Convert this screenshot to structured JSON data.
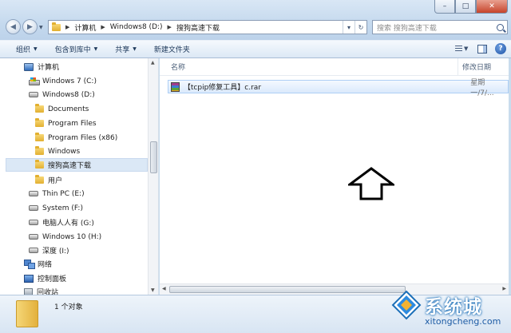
{
  "window": {
    "minimize_glyph": "–",
    "maximize_glyph": "□",
    "close_glyph": "✕"
  },
  "address": {
    "separator": "▶",
    "crumbs": [
      "计算机",
      "Windows8 (D:)",
      "搜狗高速下载"
    ],
    "refresh_glyph": "↻",
    "dropdown_glyph": "▾"
  },
  "search": {
    "placeholder": "搜索 搜狗高速下载"
  },
  "toolbar": {
    "organize": "组织",
    "include_in_library": "包含到库中",
    "share": "共享",
    "new_folder": "新建文件夹",
    "caret": "▼",
    "help": "?"
  },
  "navpane": {
    "items": [
      {
        "label": "计算机",
        "icon": "computer-icon"
      },
      {
        "label": "Windows 7  (C:)",
        "icon": "system-drive-icon"
      },
      {
        "label": "Windows8 (D:)",
        "icon": "drive-icon"
      },
      {
        "label": "Documents",
        "icon": "folder-icon"
      },
      {
        "label": "Program Files",
        "icon": "folder-icon"
      },
      {
        "label": "Program Files (x86)",
        "icon": "folder-icon"
      },
      {
        "label": "Windows",
        "icon": "folder-icon"
      },
      {
        "label": "搜狗高速下载",
        "icon": "folder-icon",
        "selected": true
      },
      {
        "label": "用户",
        "icon": "folder-icon"
      },
      {
        "label": "Thin PC (E:)",
        "icon": "drive-icon"
      },
      {
        "label": "System (F:)",
        "icon": "drive-icon"
      },
      {
        "label": "电脑人人有 (G:)",
        "icon": "drive-icon"
      },
      {
        "label": "Windows 10 (H:)",
        "icon": "drive-icon"
      },
      {
        "label": "深度 (I:)",
        "icon": "drive-icon"
      },
      {
        "label": "网络",
        "icon": "network-icon"
      },
      {
        "label": "控制面板",
        "icon": "control-panel-icon"
      },
      {
        "label": "回收站",
        "icon": "recycle-bin-icon"
      }
    ]
  },
  "content": {
    "columns": {
      "name": "名称",
      "date": "修改日期"
    },
    "files": [
      {
        "name": "【tcpip修复工具】c.rar",
        "date": "星期一/7/...",
        "icon": "rar-archive-icon"
      }
    ]
  },
  "status": {
    "item_count": "1 个对象"
  },
  "watermark": {
    "brand": "系统城",
    "url": "xitongcheng.com"
  },
  "colors": {
    "accent": "#1c6fb8",
    "selection": "#dbe8f6",
    "chrome": "#c9dced"
  }
}
